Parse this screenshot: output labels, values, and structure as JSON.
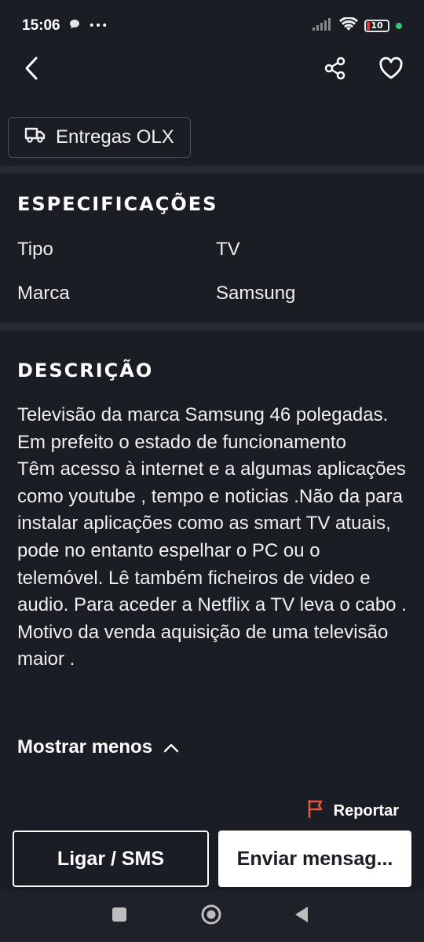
{
  "status": {
    "time": "15:06",
    "more": "•••",
    "battery": "10"
  },
  "header": {
    "back_icon": "chevron-left-icon",
    "share_icon": "share-icon",
    "favorite_icon": "heart-outline-icon"
  },
  "delivery": {
    "label": "Entregas OLX",
    "icon": "truck-icon"
  },
  "specs": {
    "title": "ESPECIFICAÇÕES",
    "rows": [
      {
        "key": "Tipo",
        "value": "TV"
      },
      {
        "key": "Marca",
        "value": "Samsung"
      }
    ]
  },
  "description": {
    "title": "DESCRIÇÃO",
    "text": "Televisão da marca Samsung 46 polegadas. Em prefeito o estado de funcionamento\nTêm acesso à internet e a algumas aplicações como youtube , tempo e noticias .Não da para instalar aplicações como as smart TV atuais, pode no entanto espelhar o PC ou o telemóvel. Lê também ficheiros de video e audio. Para aceder a Netflix a TV leva o cabo .\nMotivo da venda aquisição de uma televisão maior .",
    "toggle_label": "Mostrar menos"
  },
  "report": {
    "label": "Reportar",
    "color": "#e8553b"
  },
  "actions": {
    "call_label": "Ligar / SMS",
    "message_label": "Enviar mensag..."
  }
}
